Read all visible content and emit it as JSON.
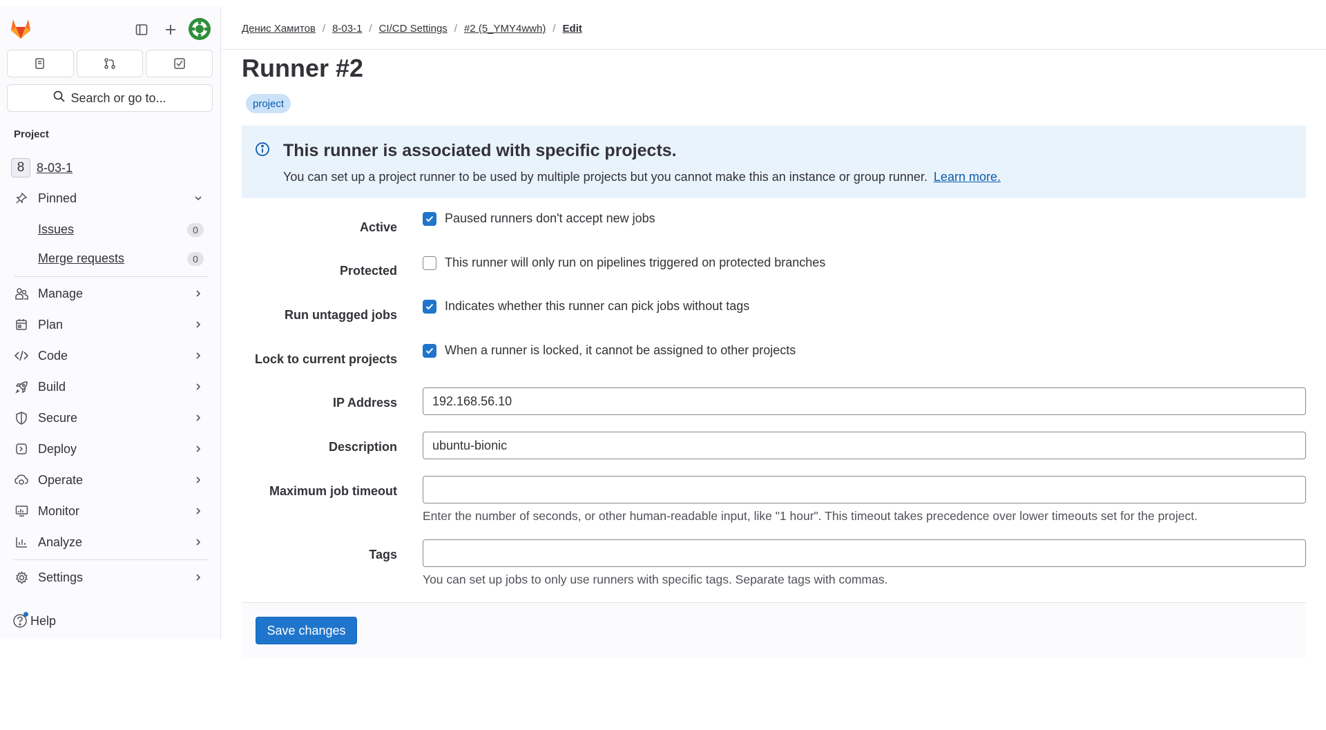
{
  "sidebar": {
    "search_label": "Search or go to...",
    "section_title": "Project",
    "project": {
      "badge": "8",
      "name": "8-03-1"
    },
    "pinned": {
      "label": "Pinned",
      "icon": "pin-icon"
    },
    "pinned_items": [
      {
        "label": "Issues",
        "count": "0"
      },
      {
        "label": "Merge requests",
        "count": "0"
      }
    ],
    "nav": [
      {
        "label": "Manage",
        "icon": "users-icon"
      },
      {
        "label": "Plan",
        "icon": "calendar-icon"
      },
      {
        "label": "Code",
        "icon": "code-icon"
      },
      {
        "label": "Build",
        "icon": "rocket-icon"
      },
      {
        "label": "Secure",
        "icon": "shield-icon"
      },
      {
        "label": "Deploy",
        "icon": "deploy-icon"
      },
      {
        "label": "Operate",
        "icon": "cloud-gear-icon"
      },
      {
        "label": "Monitor",
        "icon": "monitor-icon"
      },
      {
        "label": "Analyze",
        "icon": "chart-icon"
      }
    ],
    "settings": "Settings",
    "help": "Help"
  },
  "breadcrumb": {
    "items": [
      "Денис Хамитов",
      "8-03-1",
      "CI/CD Settings",
      "#2 (5_YMY4wwh)"
    ],
    "current": "Edit"
  },
  "page": {
    "title": "Runner #2",
    "badge": "project"
  },
  "alert": {
    "title": "This runner is associated with specific projects.",
    "body": "You can set up a project runner to be used by multiple projects but you cannot make this an instance or group runner.",
    "link": "Learn more."
  },
  "form": {
    "active": {
      "label": "Active",
      "text": "Paused runners don't accept new jobs",
      "checked": true
    },
    "protected": {
      "label": "Protected",
      "text": "This runner will only run on pipelines triggered on protected branches",
      "checked": false
    },
    "untagged": {
      "label": "Run untagged jobs",
      "text": "Indicates whether this runner can pick jobs without tags",
      "checked": true
    },
    "locked": {
      "label": "Lock to current projects",
      "text": "When a runner is locked, it cannot be assigned to other projects",
      "checked": true
    },
    "ip": {
      "label": "IP Address",
      "value": "192.168.56.10"
    },
    "description": {
      "label": "Description",
      "value": "ubuntu-bionic"
    },
    "timeout": {
      "label": "Maximum job timeout",
      "value": "",
      "help": "Enter the number of seconds, or other human-readable input, like \"1 hour\". This timeout takes precedence over lower timeouts set for the project."
    },
    "tags": {
      "label": "Tags",
      "value": "",
      "help": "You can set up jobs to only use runners with specific tags. Separate tags with commas."
    },
    "save_label": "Save changes"
  },
  "colors": {
    "accent": "#1f75cb",
    "alert_bg": "#e9f3fc",
    "badge_bg": "#cbe2f9"
  }
}
